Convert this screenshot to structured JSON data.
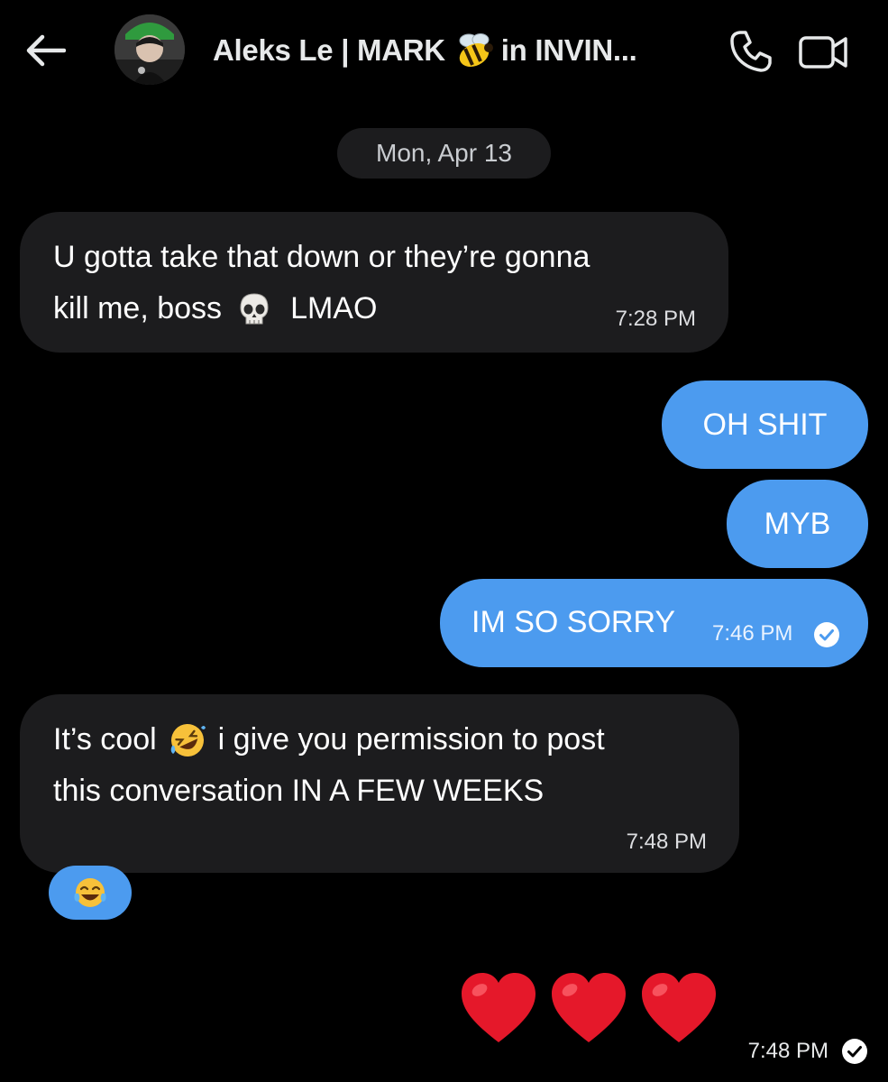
{
  "header": {
    "contact_name_part1": "Aleks Le | MARK",
    "contact_name_part2": "in INVIN...",
    "icons": {
      "back": "arrow-left-icon",
      "avatar": "avatar",
      "name_emoji": "bee-emoji-icon",
      "call": "phone-icon",
      "video": "video-camera-icon"
    }
  },
  "date_separator": "Mon, Apr 13",
  "messages": [
    {
      "direction": "incoming",
      "lines": [
        "U gotta take that down or they’re gonna",
        "kill me, boss",
        "LMAO"
      ],
      "emoji": "skull-emoji-icon",
      "time": "7:28 PM"
    },
    {
      "direction": "outgoing",
      "text": "OH SHIT"
    },
    {
      "direction": "outgoing",
      "text": "MYB"
    },
    {
      "direction": "outgoing",
      "text": "IM SO SORRY",
      "time": "7:46 PM",
      "status": "read-check-icon"
    },
    {
      "direction": "incoming",
      "lines": [
        "It’s cool",
        "i give you permission to post",
        "this conversation IN A FEW WEEKS"
      ],
      "emoji": "rolling-laughing-emoji-icon",
      "time": "7:48 PM",
      "reaction": "tears-of-joy-emoji-icon"
    },
    {
      "direction": "outgoing",
      "emoji_only": [
        "red-heart-emoji-icon",
        "red-heart-emoji-icon",
        "red-heart-emoji-icon"
      ],
      "time": "7:48 PM",
      "status": "read-check-icon"
    }
  ],
  "colors": {
    "background": "#000000",
    "incoming_bubble": "#1c1c1e",
    "outgoing_bubble": "#4c9bef",
    "text": "#ffffff"
  }
}
